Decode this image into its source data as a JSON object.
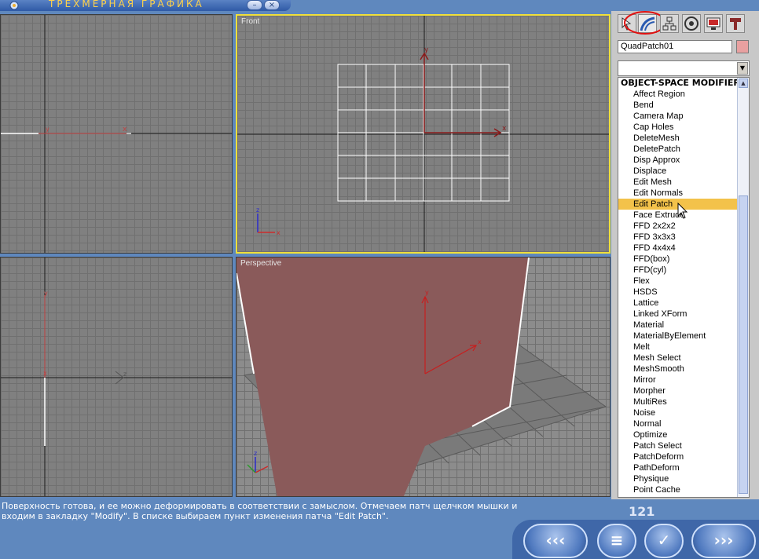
{
  "window": {
    "title": "ТРЕХМЕРНАЯ ГРАФИКА",
    "minimize_glyph": "–",
    "close_glyph": "×"
  },
  "viewports": {
    "top_left": {
      "label": ""
    },
    "front": {
      "label": "Front"
    },
    "left": {
      "label": ""
    },
    "perspective": {
      "label": "Perspective"
    }
  },
  "command_panel": {
    "tabs": [
      "create-icon",
      "modify-icon",
      "hierarchy-icon",
      "motion-icon",
      "display-icon",
      "utilities-icon"
    ],
    "object_name": "QuadPatch01",
    "object_color": "#e8a0a0",
    "modifier_list": {
      "header": "OBJECT-SPACE MODIFIERS",
      "selected": "Edit Patch",
      "items": [
        "Affect Region",
        "Bend",
        "Camera Map",
        "Cap Holes",
        "DeleteMesh",
        "DeletePatch",
        "Disp Approx",
        "Displace",
        "Edit Mesh",
        "Edit Normals",
        "Edit Patch",
        "Face Extrude",
        "FFD 2x2x2",
        "FFD 3x3x3",
        "FFD 4x4x4",
        "FFD(box)",
        "FFD(cyl)",
        "Flex",
        "HSDS",
        "Lattice",
        "Linked XForm",
        "Material",
        "MaterialByElement",
        "Melt",
        "Mesh Select",
        "MeshSmooth",
        "Mirror",
        "Morpher",
        "MultiRes",
        "Noise",
        "Normal",
        "Optimize",
        "Patch Select",
        "PatchDeform",
        "PathDeform",
        "Physique",
        "Point Cache"
      ]
    }
  },
  "status": {
    "text": "Поверхность готова, и ее можно деформировать в соответствии с замыслом. Отмечаем патч щелчком мышки и входим в закладку \"Modify\". В списке выбираем пункт изменения патча \"Edit Patch\".",
    "page_number": "121"
  },
  "navigation": {
    "prev_label": "‹‹‹",
    "menu_label": "≡",
    "ok_label": "✓",
    "next_label": "›››"
  },
  "colors": {
    "viewport_bg": "#808080",
    "active_border": "#f0e03a",
    "patch_fill": "#8a5a5a",
    "selection_highlight": "#f3c24a",
    "status_bg": "#5f88be"
  }
}
